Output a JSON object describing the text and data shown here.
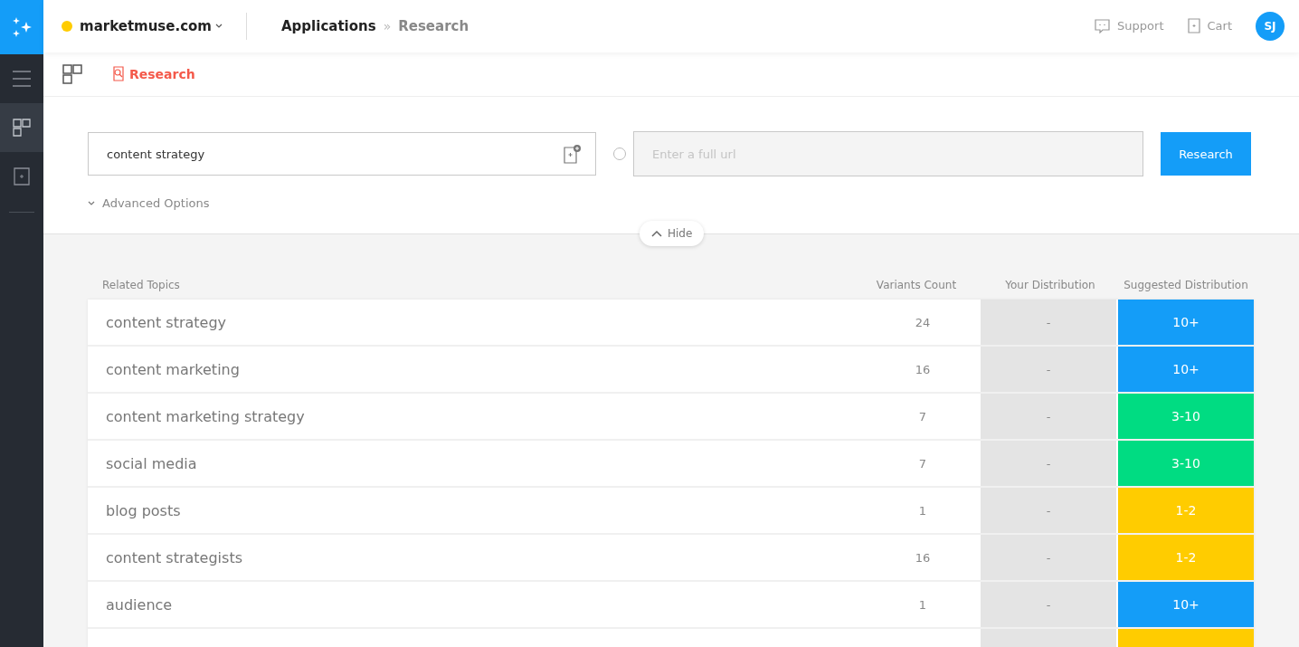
{
  "header": {
    "site": "marketmuse.com",
    "breadcrumb": [
      "Applications",
      "Research"
    ],
    "breadcrumb_separator": "»",
    "support": "Support",
    "cart": "Cart",
    "avatar": "SJ"
  },
  "sidebar": {
    "items": [
      {
        "kind": "menu",
        "selected": false
      },
      {
        "kind": "apps",
        "selected": true
      },
      {
        "kind": "add",
        "selected": false
      }
    ]
  },
  "subnav": {
    "title": "Research"
  },
  "search": {
    "query": "content strategy",
    "url_placeholder": "Enter a full url",
    "url_selected": false,
    "button": "Research",
    "advanced": "Advanced Options",
    "hide": "Hide"
  },
  "table": {
    "columns": [
      "Related Topics",
      "Variants Count",
      "Your Distribution",
      "Suggested Distribution"
    ],
    "rows": [
      {
        "topic": "content strategy",
        "count": "24",
        "yours": "-",
        "suggested": "10+",
        "color": "#149df8"
      },
      {
        "topic": "content marketing",
        "count": "16",
        "yours": "-",
        "suggested": "10+",
        "color": "#149df8"
      },
      {
        "topic": "content marketing strategy",
        "count": "7",
        "yours": "-",
        "suggested": "3-10",
        "color": "#00dc82"
      },
      {
        "topic": "social media",
        "count": "7",
        "yours": "-",
        "suggested": "3-10",
        "color": "#00dc82"
      },
      {
        "topic": "blog posts",
        "count": "1",
        "yours": "-",
        "suggested": "1-2",
        "color": "#ffcc00"
      },
      {
        "topic": "content strategists",
        "count": "16",
        "yours": "-",
        "suggested": "1-2",
        "color": "#ffcc00"
      },
      {
        "topic": "audience",
        "count": "1",
        "yours": "-",
        "suggested": "10+",
        "color": "#149df8"
      }
    ],
    "partial_row": {
      "color": "#ffcc00"
    }
  }
}
